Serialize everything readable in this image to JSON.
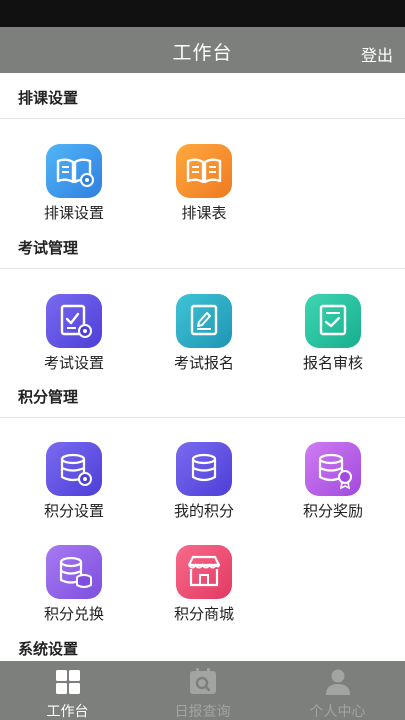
{
  "header": {
    "title": "工作台",
    "logout_label": "登出"
  },
  "sections": [
    {
      "title": "排课设置",
      "items": [
        {
          "label": "排课设置"
        },
        {
          "label": "排课表"
        }
      ]
    },
    {
      "title": "考试管理",
      "items": [
        {
          "label": "考试设置"
        },
        {
          "label": "考试报名"
        },
        {
          "label": "报名审核"
        }
      ]
    },
    {
      "title": "积分管理",
      "items": [
        {
          "label": "积分设置"
        },
        {
          "label": "我的积分"
        },
        {
          "label": "积分奖励"
        },
        {
          "label": "积分兑换"
        },
        {
          "label": "积分商城"
        }
      ]
    },
    {
      "title": "系统设置"
    }
  ],
  "tabbar": {
    "items": [
      {
        "label": "工作台",
        "icon": "grid-icon"
      },
      {
        "label": "日报查询",
        "icon": "calendar-search-icon"
      },
      {
        "label": "个人中心",
        "icon": "person-icon"
      }
    ]
  },
  "colors": {
    "header_bg": "#7d7f7d",
    "blue": "#3d8fe6",
    "orange": "#f5892b",
    "indigo": "#6250e6",
    "teal": "#29a7c1",
    "green": "#24c09f",
    "purple": "#b45ae6",
    "pink": "#f0476f"
  }
}
